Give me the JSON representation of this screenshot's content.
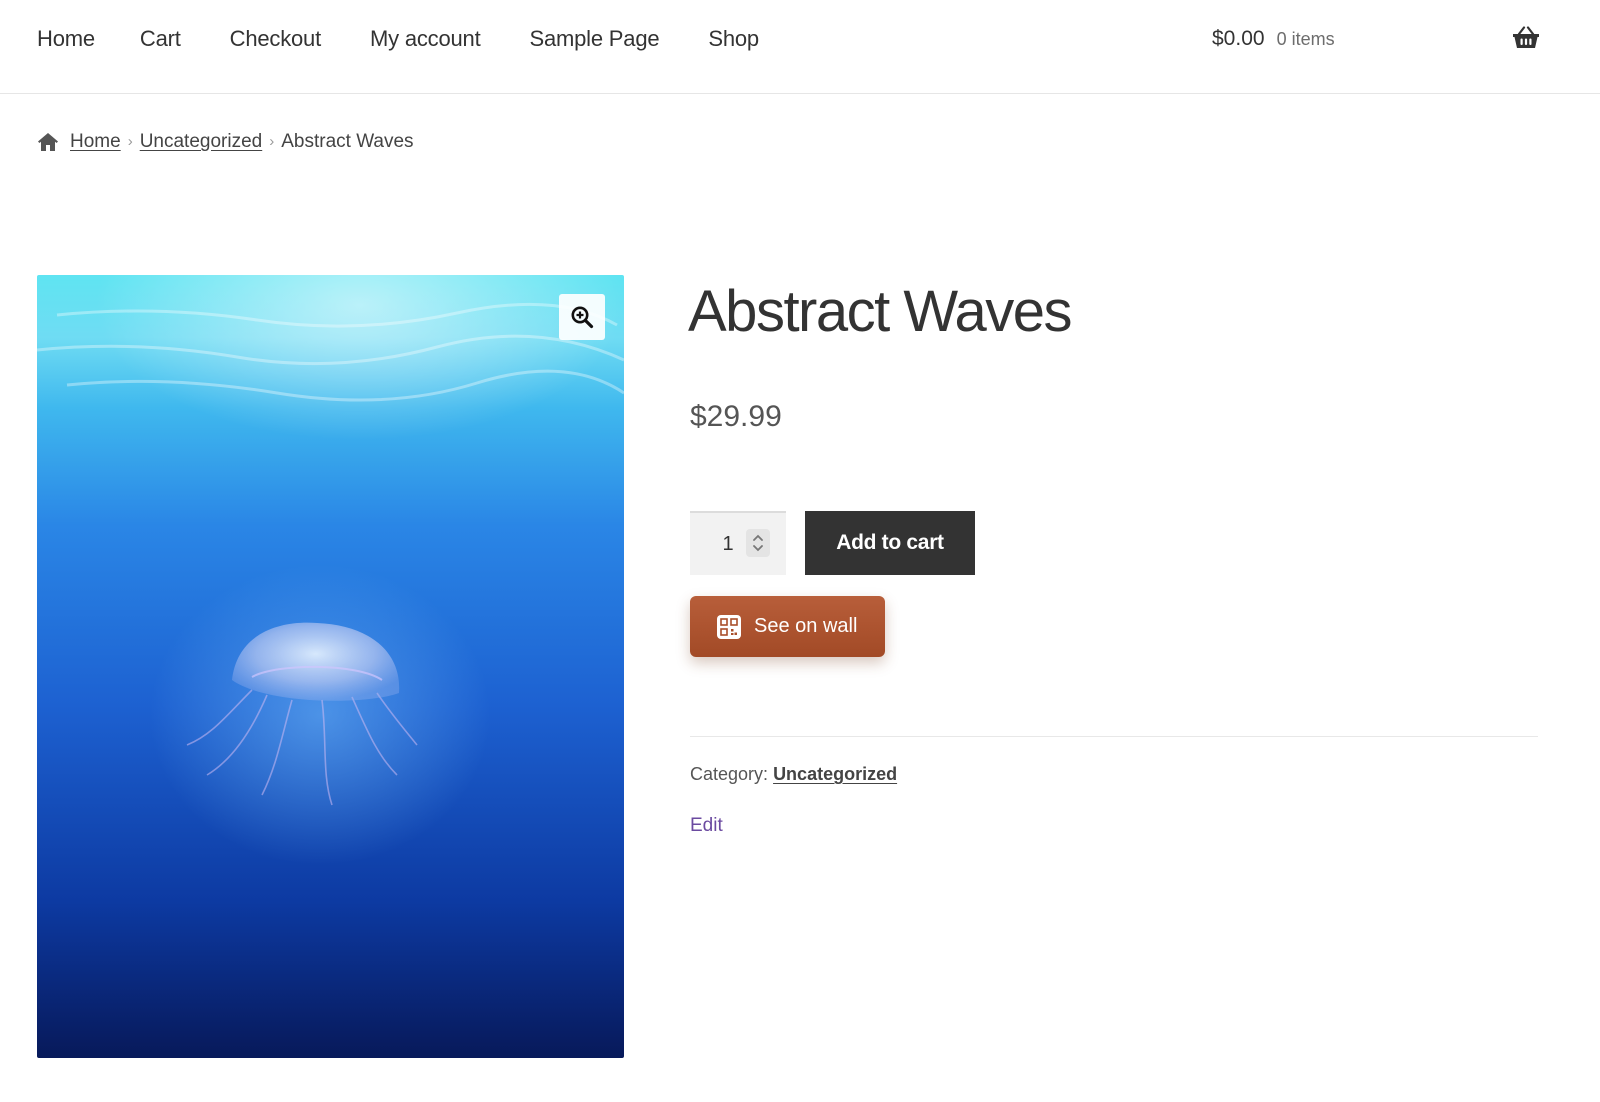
{
  "nav": {
    "items": [
      {
        "label": "Home"
      },
      {
        "label": "Cart"
      },
      {
        "label": "Checkout"
      },
      {
        "label": "My account"
      },
      {
        "label": "Sample Page"
      },
      {
        "label": "Shop"
      }
    ]
  },
  "cart": {
    "total": "$0.00",
    "count": "0 items",
    "icon": "basket-icon"
  },
  "breadcrumb": {
    "icon": "home-icon",
    "items": [
      {
        "label": "Home"
      },
      {
        "label": "Uncategorized"
      }
    ],
    "current": "Abstract Waves"
  },
  "product": {
    "title": "Abstract Waves",
    "price": "$29.99",
    "quantity": "1",
    "add_to_cart_label": "Add to cart",
    "see_on_wall_label": "See on wall",
    "category_label": "Category:",
    "category_value": "Uncategorized",
    "edit_label": "Edit",
    "zoom_icon": "zoom-in-icon",
    "image_subject": "jellyfish-underwater"
  },
  "colors": {
    "accent_dark": "#333333",
    "see_on_wall": "#a94f2b",
    "edit_link": "#6b4aa0"
  }
}
